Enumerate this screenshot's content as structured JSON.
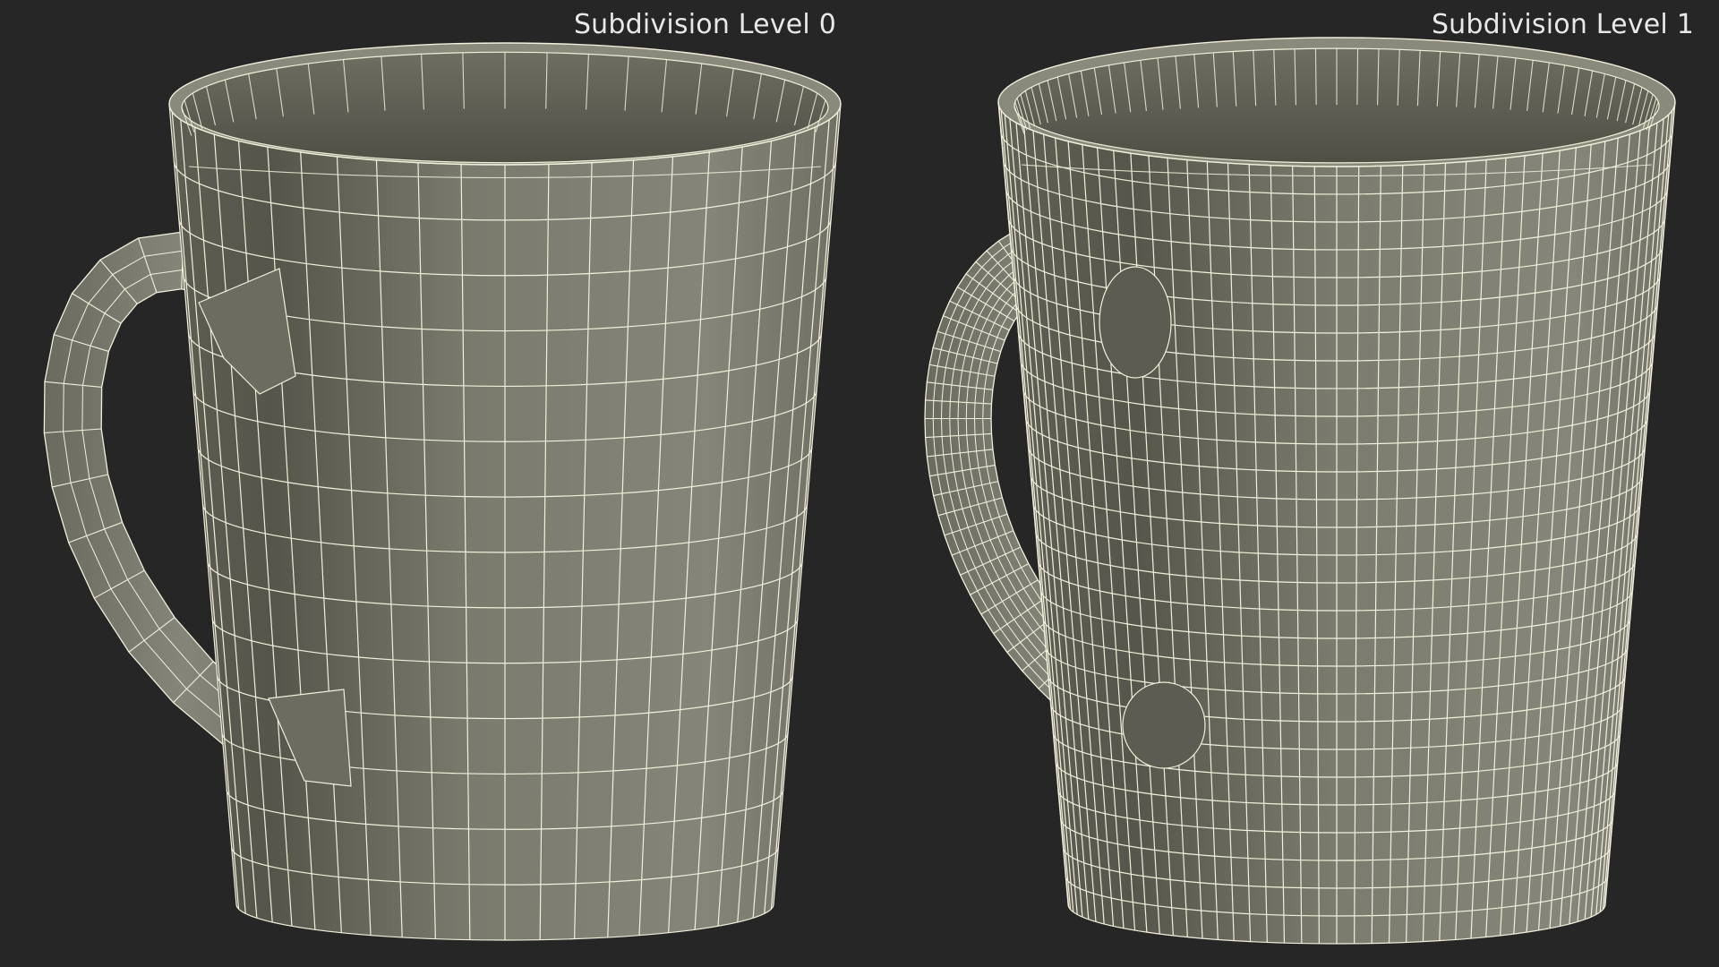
{
  "viewport": {
    "background_color": "#262626",
    "panels": [
      {
        "title": "Subdivision Level 0",
        "subdivision_level": 0
      },
      {
        "title": "Subdivision Level 1",
        "subdivision_level": 1
      }
    ]
  },
  "colors": {
    "mug_surface": "#7c7c6e",
    "mug_inner": "#646458",
    "mug_rim": "#8a8a7c",
    "wireframe": "#f2f0dc"
  }
}
